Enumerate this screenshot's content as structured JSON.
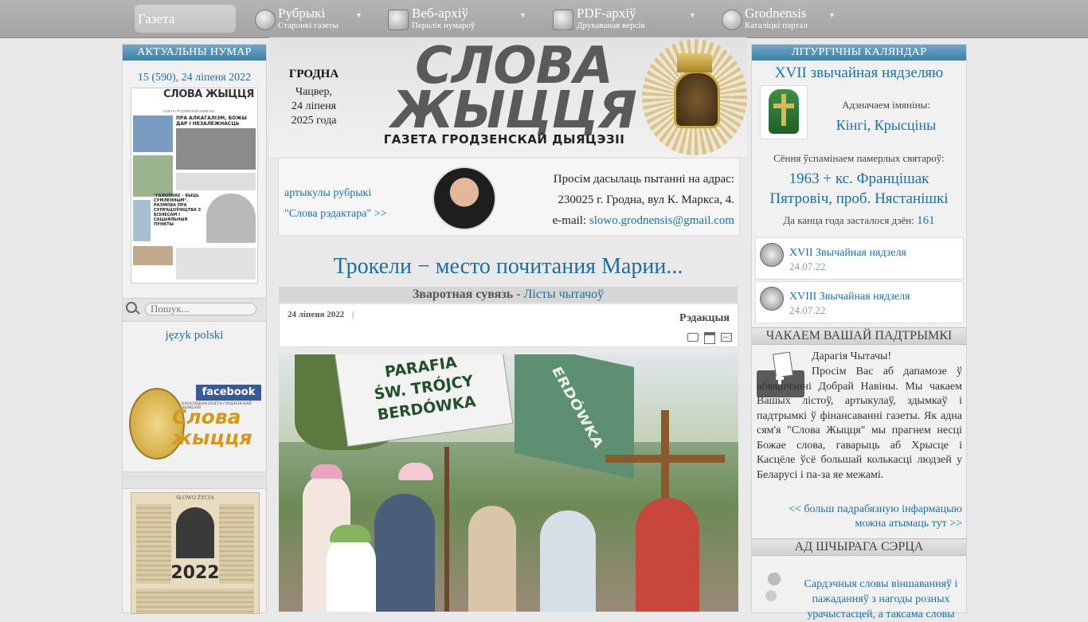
{
  "nav": {
    "active": "Газета",
    "items": [
      {
        "title": "Рубрыкі",
        "sub": "Старонкі газеты"
      },
      {
        "title": "Веб-архіў",
        "sub": "Пералік нумароў"
      },
      {
        "title": "PDF-архіў",
        "sub": "Друкаваная версія"
      },
      {
        "title": "Grodnensis",
        "sub": "Каталіцкі партал"
      }
    ]
  },
  "left": {
    "current_issue_header": "АКТУАЛЬНЫ НУМАР",
    "issue_link": "15 (590), 24 ліпеня 2022",
    "thumb": {
      "masthead": "СЛОВА ЖЫЦЦЯ",
      "sub": "ГАЗЕТА ГРОДЗЕНСКАЙ ДЫЯЦЭЗІІ",
      "headline1": "ПРА АЛКАГАЛІЗМ, БОЖЫ ДАР І НЕЗАЛЕЖНАСЦЬ",
      "headline2": "\"ГАЛОЎНАЕ – БЫЦЬ СУМЛЕННЫМ\". РАЗМОВА ПРА СУПРАЦОЎНІЦТВА З БІЗНЕСАМ І САЦЫЯЛЬНЫЯ ПУНКТЫ"
    },
    "search_placeholder": "Пошук...",
    "polish_link": "język polski",
    "facebook_label": "facebook",
    "fb_logo_text": "Слова жыцця",
    "fb_logo_sub": "КАТАЛІЦКАЯ ГАЗЕТА ГРОДЗЕНСКАЙ ДЫЯЦЭЗІІ",
    "calendar_title": "SŁOWO ŻYCIA",
    "calendar_year": "2022"
  },
  "center": {
    "city": "ГРОДНА",
    "weekday": "Чацвер,",
    "date": "24 ліпеня",
    "year": "2025 года",
    "logo_line1": "СЛОВА",
    "logo_line2": "ЖЫЦЦЯ",
    "logo_sub": "ГАЗЕТА ГРОДЗЕНСКАЙ ДЫЯЦЭЗІІ",
    "editor_link1": "артыкулы рубрыкі",
    "editor_link2": "\"Слова рэдактара\" >>",
    "address_label": "Просім дасылаць пытанні на адрас:",
    "address": "230025 г. Гродна, вул К. Маркса, 4.",
    "email_label": "e-mail:",
    "email": "slowo.grodnensis@gmail.com",
    "article_title": "Трокели − место почитания Марии...",
    "category": "Зваротная сувязь",
    "category_sep": "-",
    "subcategory": "Лісты чытачоў",
    "article_date": "24 ліпеня 2022",
    "date_sep": "|",
    "author": "Рэдакцыя",
    "photo_sign1": "PARAFIA",
    "photo_sign2": "ŚW. TRÓJCY",
    "photo_sign3": "BERDÓWKA",
    "photo_flag": "ERDÓWKA"
  },
  "right": {
    "calendar_header": "ЛІТУРГІЧНЫ КАЛЯНДАР",
    "sunday": "XVII звычайная нядзеляю",
    "namedays_label": "Адзначаем імяніны:",
    "namedays": "Кінгі, Крысціны",
    "deceased_label": "Сёння ўспамінаем памерлых святароў:",
    "deceased": "1963 + кс. Францішак Пятровіч, проб. Нястанішкі",
    "days_left_label": "Да канца года засталося дзён:",
    "days_left": "161",
    "homilies": [
      {
        "title": "XVII Звычайная нядзеля",
        "date": "24.07.22"
      },
      {
        "title": "XVIII Звычайная нядзеля",
        "date": "24.07.22"
      }
    ],
    "support_header": "ЧАКАЕМ ВАШАЙ ПАДТРЫМКІ",
    "support_greeting": "Дарагія Чытачы!",
    "support_text": "Просім Вас аб дапамозе ў абвяшчэнні Добрай Навіны. Мы чакаем Вашых лістоў, артыкулаў, здымкаў і падтрымкі ў фінансаванні газеты. Як адна сям'я \"Слова Жыцця\" мы прагнем несці Божае слова, гаварыць аб Хрысце і Касцёле ўсё большай колькасці людзей у Беларусі і па-за яе межамі.",
    "support_link1": "<< больш падрабязную інфармацыю",
    "support_link2": "можна атымаць тут >>",
    "heart_header": "АД ШЧЫРАГА СЭРЦА",
    "heart_text": "Сардэчныя словы віншаванняў і пажаданняў з нагоды розных урачыстасцей, а таксама словы"
  },
  "colors": {
    "link": "#1d6f9e",
    "nav_bg": "#aaaaaa",
    "blue_header": "#4b89ad",
    "vestment": "#2e7d32"
  }
}
